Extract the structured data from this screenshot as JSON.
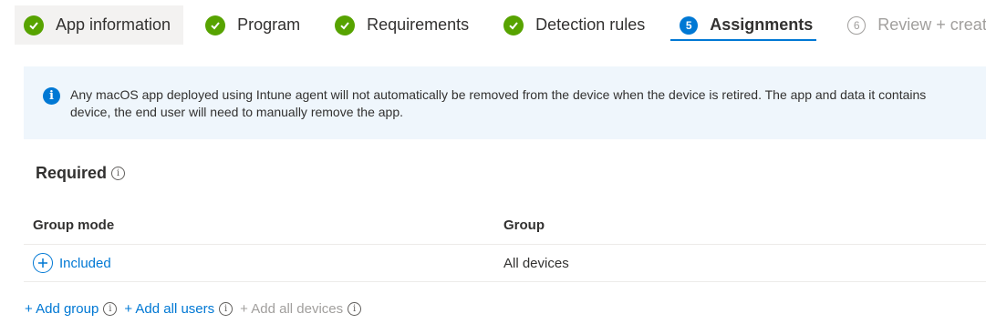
{
  "wizard": {
    "steps": [
      {
        "label": "App information",
        "state": "complete"
      },
      {
        "label": "Program",
        "state": "complete"
      },
      {
        "label": "Requirements",
        "state": "complete"
      },
      {
        "label": "Detection rules",
        "state": "complete"
      },
      {
        "label": "Assignments",
        "number": "5",
        "state": "current"
      },
      {
        "label": "Review + create",
        "number": "6",
        "state": "disabled"
      }
    ]
  },
  "banner": {
    "icon": "info-icon",
    "line1": "Any macOS app deployed using Intune agent will not automatically be removed from the device when the device is retired. The app and data it contains",
    "line2": "device, the end user will need to manually remove the app."
  },
  "section": {
    "title": "Required"
  },
  "table": {
    "headers": [
      "Group mode",
      "Group"
    ],
    "rows": [
      {
        "mode": "Included",
        "group": "All devices"
      }
    ]
  },
  "actions": {
    "add_group": "+ Add group",
    "add_all_users": "+ Add all users",
    "add_all_devices": "+ Add all devices"
  },
  "colors": {
    "accent": "#0078d4",
    "complete": "#57a300",
    "banner_bg": "#eff6fc",
    "disabled": "#a19f9d"
  }
}
